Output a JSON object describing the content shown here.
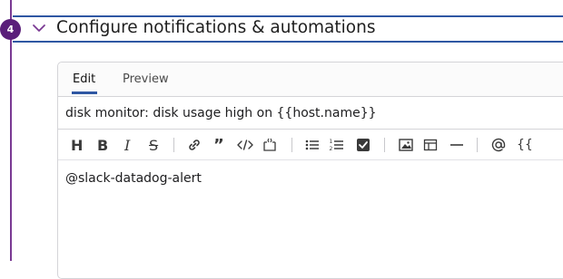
{
  "section": {
    "step_number": "4",
    "title": "Configure notifications & automations",
    "accent_color": "#5a1f7a",
    "line_color": "#2f57a3"
  },
  "editor": {
    "tabs": [
      {
        "label": "Edit",
        "active": true
      },
      {
        "label": "Preview",
        "active": false
      }
    ],
    "title_value": "disk monitor: disk usage high on {{host.name}}",
    "message_body": "@slack-datadog-alert",
    "toolbar": {
      "heading": "H",
      "bold": "B",
      "italic": "I",
      "strikethrough": "S",
      "quote": "”",
      "variables": "{{"
    }
  }
}
